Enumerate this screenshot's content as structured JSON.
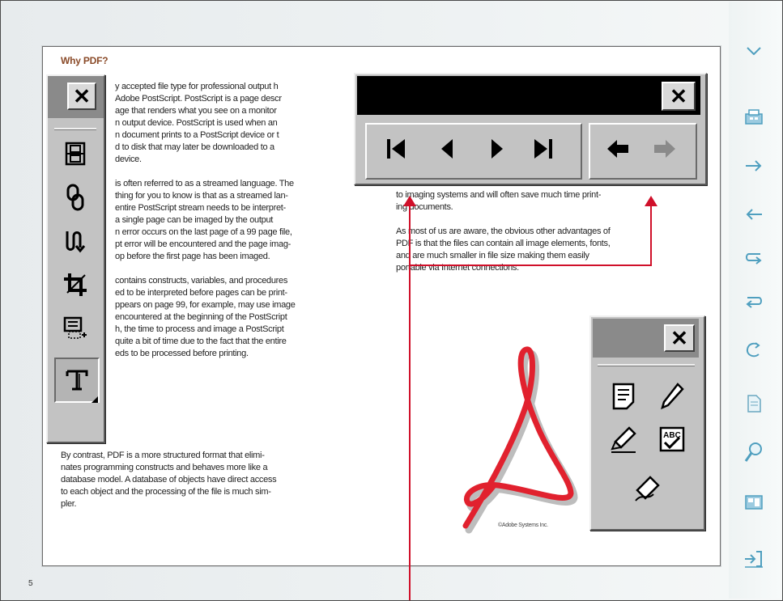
{
  "page": {
    "heading": "Why PDF?",
    "page_number": "5",
    "left_column": [
      "y accepted file type for professional output h",
      "Adobe PostScript. PostScript is a page descr",
      "age that renders what you see on a monitor",
      "n output device. PostScript is used when an",
      "n document prints to a PostScript device or t",
      "d to disk that may later be downloaded to a",
      " device.",
      "",
      " is often referred to as a streamed language. The",
      " thing for you to know is that as a streamed lan-",
      " entire PostScript stream needs to be interpret-",
      " a single page can be imaged by the output",
      " n error occurs on the last page of a 99 page file,",
      " pt error will be encountered and the page imag-",
      " op before the first page has been imaged.",
      "",
      " contains constructs, variables, and procedures",
      " ed to be interpreted before pages can be print-",
      " ppears on page 99, for example, may use image",
      " encountered at the beginning of the PostScript",
      " h, the time to process and image a PostScript",
      " quite a bit of time due to the fact that the entire",
      " eds to be processed before printing."
    ],
    "left_column_full": [
      "By contrast, PDF is a more structured format that elimi-",
      "nates programming constructs and behaves more like a",
      "database model. A database of objects have direct access",
      "to each object and the processing of the file is much sim-",
      "pler."
    ],
    "right_column": [
      "to imaging systems and will often save much time print-",
      "ing documents.",
      "",
      "As most of us are aware, the obvious other advantages of",
      "PDF is that the files can contain all image elements, fonts,",
      "and are much smaller in file size making them easily",
      "portable via Internet connections."
    ],
    "logo_caption": "©Adobe Systems Inc."
  },
  "tools_palette": {
    "close_label": "✕",
    "tools": [
      "movie-tool",
      "link-tool",
      "article-tool",
      "crop-tool",
      "form-tool",
      "text-touchup-tool"
    ]
  },
  "nav_palette": {
    "close_label": "✕",
    "first_glyph": "|◀",
    "prev_glyph": "◀",
    "next_glyph": "▶",
    "last_glyph": "▶|",
    "back_glyph": "🡄",
    "forward_glyph": "🡆"
  },
  "annot_palette": {
    "close_label": "✕",
    "tools": [
      "note-tool",
      "pencil-tool",
      "highlight-tool",
      "spell-check-tool",
      "signature-tool"
    ],
    "spell_label": "ABC"
  },
  "sidebar": {
    "icons": [
      "chevron-down",
      "print",
      "next",
      "previous",
      "go-back",
      "go-forward",
      "refresh",
      "document",
      "search",
      "thumbnails",
      "exit"
    ]
  },
  "colors": {
    "accent": "#4f9fbf",
    "heading": "#8a4a28",
    "callout_line": "#d0102a",
    "palette_grey": "#c3c3c3",
    "title_bar_active": "#000000"
  }
}
